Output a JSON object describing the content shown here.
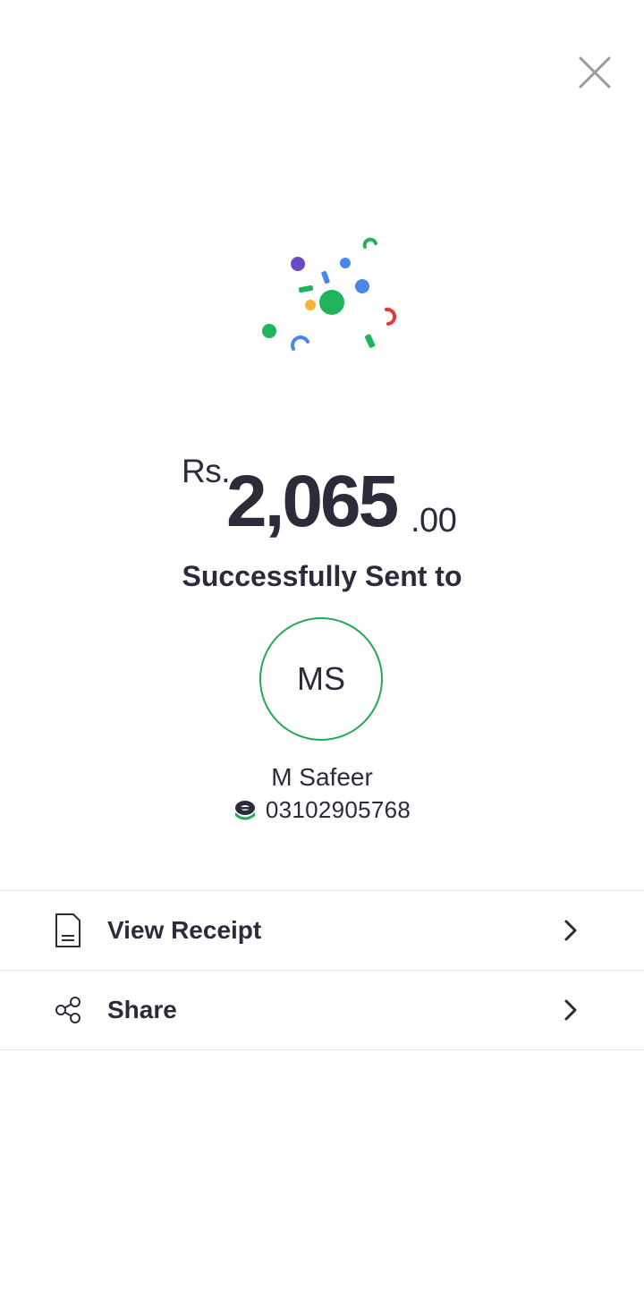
{
  "close": {
    "icon": "close-icon"
  },
  "confetti": {
    "icon": "confetti-icon"
  },
  "amount": {
    "currency": "Rs.",
    "whole": "2,065",
    "fraction": ".00"
  },
  "status": {
    "label": "Successfully Sent to"
  },
  "recipient": {
    "initials": "MS",
    "name": "M Safeer",
    "phone": "03102905768",
    "provider_icon": "easypaisa-logo-icon"
  },
  "actions": [
    {
      "label": "View Receipt",
      "icon": "receipt-icon"
    },
    {
      "label": "Share",
      "icon": "share-icon"
    }
  ],
  "colors": {
    "accent_green": "#22a957",
    "text": "#2b2b3a",
    "divider": "#e6e6ea"
  }
}
